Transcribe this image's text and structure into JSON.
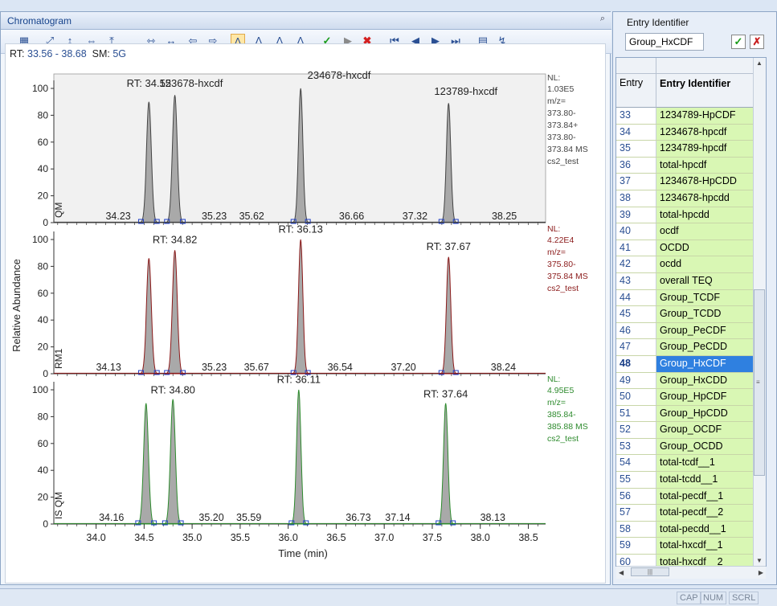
{
  "panel": {
    "title": "Chromatogram",
    "pin_icon": "pin-icon"
  },
  "toolbar_icons": [
    "grid-icon",
    "zoom-xy-icon",
    "zoom-y-icon",
    "zoom-x-icon",
    "scale-y-icon",
    "fit-x-icon",
    "fit-xy-icon",
    "arrow-left-icon",
    "arrow-right-icon",
    "peak-icon",
    "peak-add-icon",
    "peak-remove-icon",
    "peak-edit-icon",
    "accept-icon",
    "cursor-icon",
    "reject-icon",
    "first-icon",
    "prev-icon",
    "next-icon",
    "last-icon",
    "document-icon",
    "export-icon"
  ],
  "rt_range": {
    "label_rt": "RT:",
    "range": "33.56 - 38.68",
    "label_sm": "SM:",
    "sm": "5G"
  },
  "chart_data": {
    "type": "line",
    "xlabel": "Time (min)",
    "ylabel": "Relative Abundance",
    "xlim": [
      33.56,
      38.68
    ],
    "ylim": [
      0,
      100
    ],
    "x_ticks": [
      "34.0",
      "34.5",
      "35.0",
      "35.5",
      "36.0",
      "36.5",
      "37.0",
      "37.5",
      "38.0",
      "38.5"
    ],
    "y_ticks": [
      "0",
      "20",
      "40",
      "60",
      "80",
      "100"
    ],
    "panels": [
      {
        "name": "QM",
        "color": "#444444",
        "nl_label": "NL:",
        "nl": "1.03E5",
        "mz": [
          "m/z=",
          "373.80-",
          "373.84+",
          "373.80-",
          "373.84  MS",
          "cs2_test"
        ],
        "peaks": [
          {
            "rt": 34.55,
            "height": 90,
            "width": 0.055
          },
          {
            "rt": 34.82,
            "height": 95,
            "width": 0.055
          },
          {
            "rt": 36.13,
            "height": 100,
            "width": 0.05
          },
          {
            "rt": 37.67,
            "height": 89,
            "width": 0.05
          }
        ],
        "labels": [
          {
            "x": 34.55,
            "y": 100,
            "text": "RT: 34.55"
          },
          {
            "x": 34.99,
            "y": 100,
            "text": "123678-hxcdf"
          },
          {
            "x": 36.53,
            "y": 106,
            "text": "234678-hxcdf"
          },
          {
            "x": 37.85,
            "y": 94,
            "text": "123789-hxcdf"
          }
        ],
        "baseline_labels": [
          {
            "x": 34.23,
            "text": "34.23"
          },
          {
            "x": 35.23,
            "text": "35.23"
          },
          {
            "x": 35.62,
            "text": "35.62"
          },
          {
            "x": 36.66,
            "text": "36.66"
          },
          {
            "x": 37.32,
            "text": "37.32"
          },
          {
            "x": 38.25,
            "text": "38.25"
          }
        ]
      },
      {
        "name": "RM1",
        "color": "#8b1a1a",
        "nl_label": "NL:",
        "nl": "4.22E4",
        "mz": [
          "m/z=",
          "375.80-",
          "375.84  MS",
          "cs2_test"
        ],
        "peaks": [
          {
            "rt": 34.55,
            "height": 86,
            "width": 0.055
          },
          {
            "rt": 34.82,
            "height": 92,
            "width": 0.055
          },
          {
            "rt": 36.13,
            "height": 100,
            "width": 0.05
          },
          {
            "rt": 37.67,
            "height": 87,
            "width": 0.05
          }
        ],
        "labels": [
          {
            "x": 34.82,
            "y": 96,
            "text": "RT: 34.82"
          },
          {
            "x": 36.13,
            "y": 104,
            "text": "RT: 36.13"
          },
          {
            "x": 37.67,
            "y": 91,
            "text": "RT: 37.67"
          }
        ],
        "baseline_labels": [
          {
            "x": 34.13,
            "text": "34.13"
          },
          {
            "x": 35.23,
            "text": "35.23"
          },
          {
            "x": 35.67,
            "text": "35.67"
          },
          {
            "x": 36.54,
            "text": "36.54"
          },
          {
            "x": 37.2,
            "text": "37.20"
          },
          {
            "x": 38.24,
            "text": "38.24"
          }
        ]
      },
      {
        "name": "IS QM",
        "color": "#2e8b2e",
        "nl_label": "NL:",
        "nl": "4.95E5",
        "mz": [
          "m/z=",
          "385.84-",
          "385.88  MS",
          "cs2_test"
        ],
        "peaks": [
          {
            "rt": 34.52,
            "height": 90,
            "width": 0.055
          },
          {
            "rt": 34.8,
            "height": 93,
            "width": 0.055
          },
          {
            "rt": 36.11,
            "height": 100,
            "width": 0.05
          },
          {
            "rt": 37.64,
            "height": 90,
            "width": 0.05
          }
        ],
        "labels": [
          {
            "x": 34.8,
            "y": 96,
            "text": "RT: 34.80"
          },
          {
            "x": 36.11,
            "y": 104,
            "text": "RT: 36.11"
          },
          {
            "x": 37.64,
            "y": 93,
            "text": "RT: 37.64"
          }
        ],
        "baseline_labels": [
          {
            "x": 34.16,
            "text": "34.16"
          },
          {
            "x": 35.2,
            "text": "35.20"
          },
          {
            "x": 35.59,
            "text": "35.59"
          },
          {
            "x": 36.73,
            "text": "36.73"
          },
          {
            "x": 37.14,
            "text": "37.14"
          },
          {
            "x": 38.13,
            "text": "38.13"
          }
        ]
      }
    ]
  },
  "entry": {
    "label": "Entry Identifier",
    "value": "Group_HxCDF",
    "col_entry": "Entry",
    "col_identifier": "Entry Identifier",
    "selected": 48,
    "rows": [
      {
        "n": "33",
        "id": "1234789-HpCDF"
      },
      {
        "n": "34",
        "id": "1234678-hpcdf"
      },
      {
        "n": "35",
        "id": "1234789-hpcdf"
      },
      {
        "n": "36",
        "id": "total-hpcdf"
      },
      {
        "n": "37",
        "id": "1234678-HpCDD"
      },
      {
        "n": "38",
        "id": "1234678-hpcdd"
      },
      {
        "n": "39",
        "id": "total-hpcdd"
      },
      {
        "n": "40",
        "id": "ocdf"
      },
      {
        "n": "41",
        "id": "OCDD"
      },
      {
        "n": "42",
        "id": "ocdd"
      },
      {
        "n": "43",
        "id": "overall TEQ"
      },
      {
        "n": "44",
        "id": "Group_TCDF"
      },
      {
        "n": "45",
        "id": "Group_TCDD"
      },
      {
        "n": "46",
        "id": "Group_PeCDF"
      },
      {
        "n": "47",
        "id": "Group_PeCDD"
      },
      {
        "n": "48",
        "id": "Group_HxCDF"
      },
      {
        "n": "49",
        "id": "Group_HxCDD"
      },
      {
        "n": "50",
        "id": "Group_HpCDF"
      },
      {
        "n": "51",
        "id": "Group_HpCDD"
      },
      {
        "n": "52",
        "id": "Group_OCDF"
      },
      {
        "n": "53",
        "id": "Group_OCDD"
      },
      {
        "n": "54",
        "id": "total-tcdf__1"
      },
      {
        "n": "55",
        "id": "total-tcdd__1"
      },
      {
        "n": "56",
        "id": "total-pecdf__1"
      },
      {
        "n": "57",
        "id": "total-pecdf__2"
      },
      {
        "n": "58",
        "id": "total-pecdd__1"
      },
      {
        "n": "59",
        "id": "total-hxcdf__1"
      },
      {
        "n": "60",
        "id": "total-hxcdf__2"
      }
    ]
  },
  "status": [
    "CAP",
    "NUM",
    "SCRL"
  ]
}
